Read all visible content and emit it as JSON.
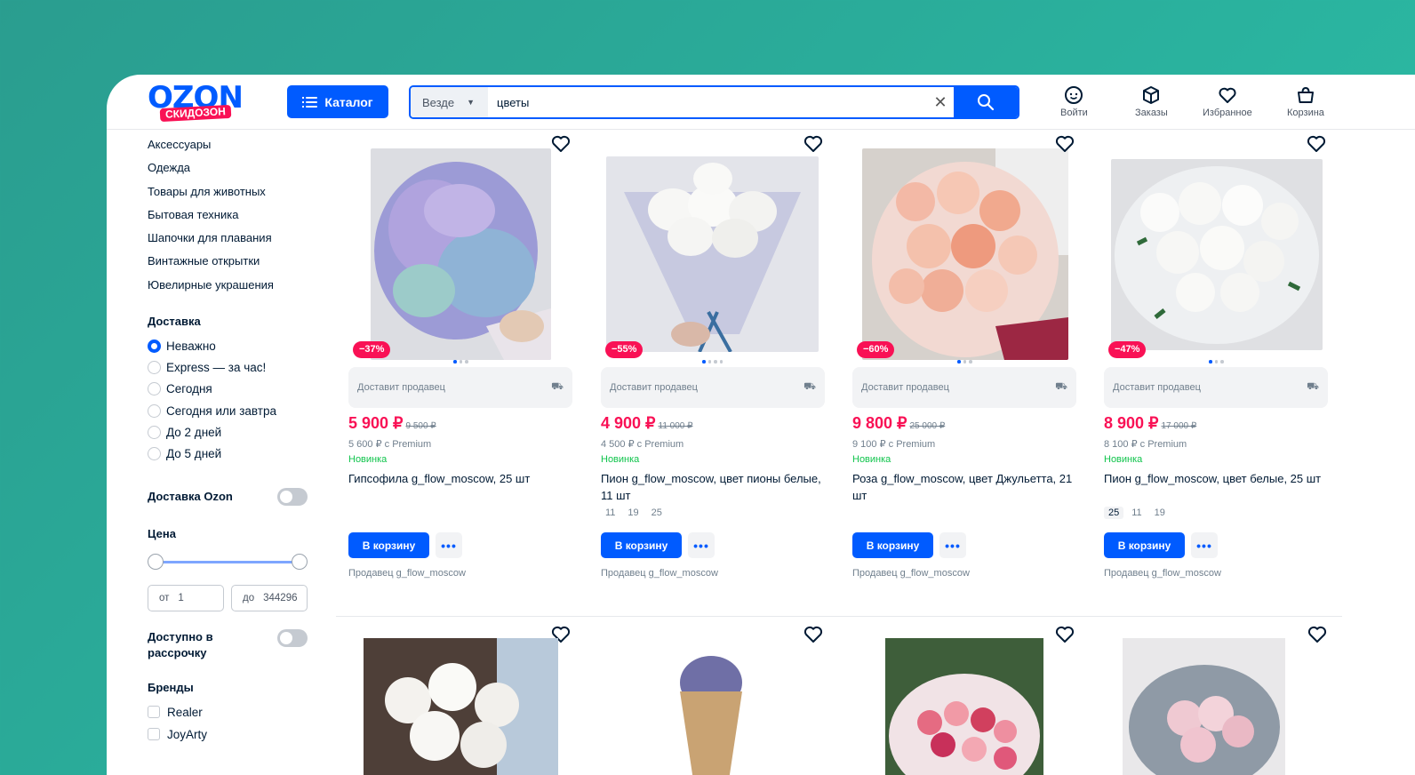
{
  "header": {
    "logo_text": "OZON",
    "logo_badge": "СКИДОЗОН",
    "catalog_label": "Каталог",
    "search_scope": "Везде",
    "search_value": "цветы",
    "nav": [
      {
        "label": "Войти",
        "icon": "user-icon"
      },
      {
        "label": "Заказы",
        "icon": "box-icon"
      },
      {
        "label": "Избранное",
        "icon": "heart-icon"
      },
      {
        "label": "Корзина",
        "icon": "cart-icon"
      }
    ]
  },
  "sidebar": {
    "categories": [
      "Аксессуары",
      "Одежда",
      "Товары для животных",
      "Бытовая техника",
      "Шапочки для плавания",
      "Винтажные открытки",
      "Ювелирные украшения"
    ],
    "delivery_title": "Доставка",
    "delivery_options": [
      "Неважно",
      "Express — за час!",
      "Сегодня",
      "Сегодня или завтра",
      "До 2 дней",
      "До 5 дней"
    ],
    "delivery_selected": 0,
    "ozon_delivery": "Доставка Ozon",
    "price_title": "Цена",
    "price_from_label": "от",
    "price_from": "1",
    "price_to_label": "до",
    "price_to": "344296",
    "installment": "Доступно в рассрочку",
    "brands_title": "Бренды",
    "brands": [
      "Realer",
      "JoyArty"
    ]
  },
  "products": [
    {
      "discount": "−37%",
      "delivery": "Доставит продавец",
      "price": "5 900 ₽",
      "old_price": "9 500 ₽",
      "premium": "5 600 ₽ с Premium",
      "tag": "Новинка",
      "title": "Гипсофила g_flow_moscow, 25 шт",
      "sizes": [],
      "cart": "В корзину",
      "seller": "Продавец g_flow_moscow"
    },
    {
      "discount": "−55%",
      "delivery": "Доставит продавец",
      "price": "4 900 ₽",
      "old_price": "11 000 ₽",
      "premium": "4 500 ₽ с Premium",
      "tag": "Новинка",
      "title": "Пион g_flow_moscow, цвет пионы белые, 11 шт",
      "sizes": [
        "11",
        "19",
        "25"
      ],
      "cart": "В корзину",
      "seller": "Продавец g_flow_moscow"
    },
    {
      "discount": "−60%",
      "delivery": "Доставит продавец",
      "price": "9 800 ₽",
      "old_price": "25 000 ₽",
      "premium": "9 100 ₽ с Premium",
      "tag": "Новинка",
      "title": "Роза g_flow_moscow, цвет Джульетта, 21 шт",
      "sizes": [],
      "cart": "В корзину",
      "seller": "Продавец g_flow_moscow"
    },
    {
      "discount": "−47%",
      "delivery": "Доставит продавец",
      "price": "8 900 ₽",
      "old_price": "17 000 ₽",
      "premium": "8 100 ₽ с Premium",
      "tag": "Новинка",
      "title": "Пион g_flow_moscow, цвет белые, 25 шт",
      "sizes": [
        "25",
        "11",
        "19"
      ],
      "cart": "В корзину",
      "seller": "Продавец g_flow_moscow"
    }
  ],
  "colors": {
    "accent": "#005bff",
    "sale": "#f91155",
    "new": "#10c44c"
  }
}
